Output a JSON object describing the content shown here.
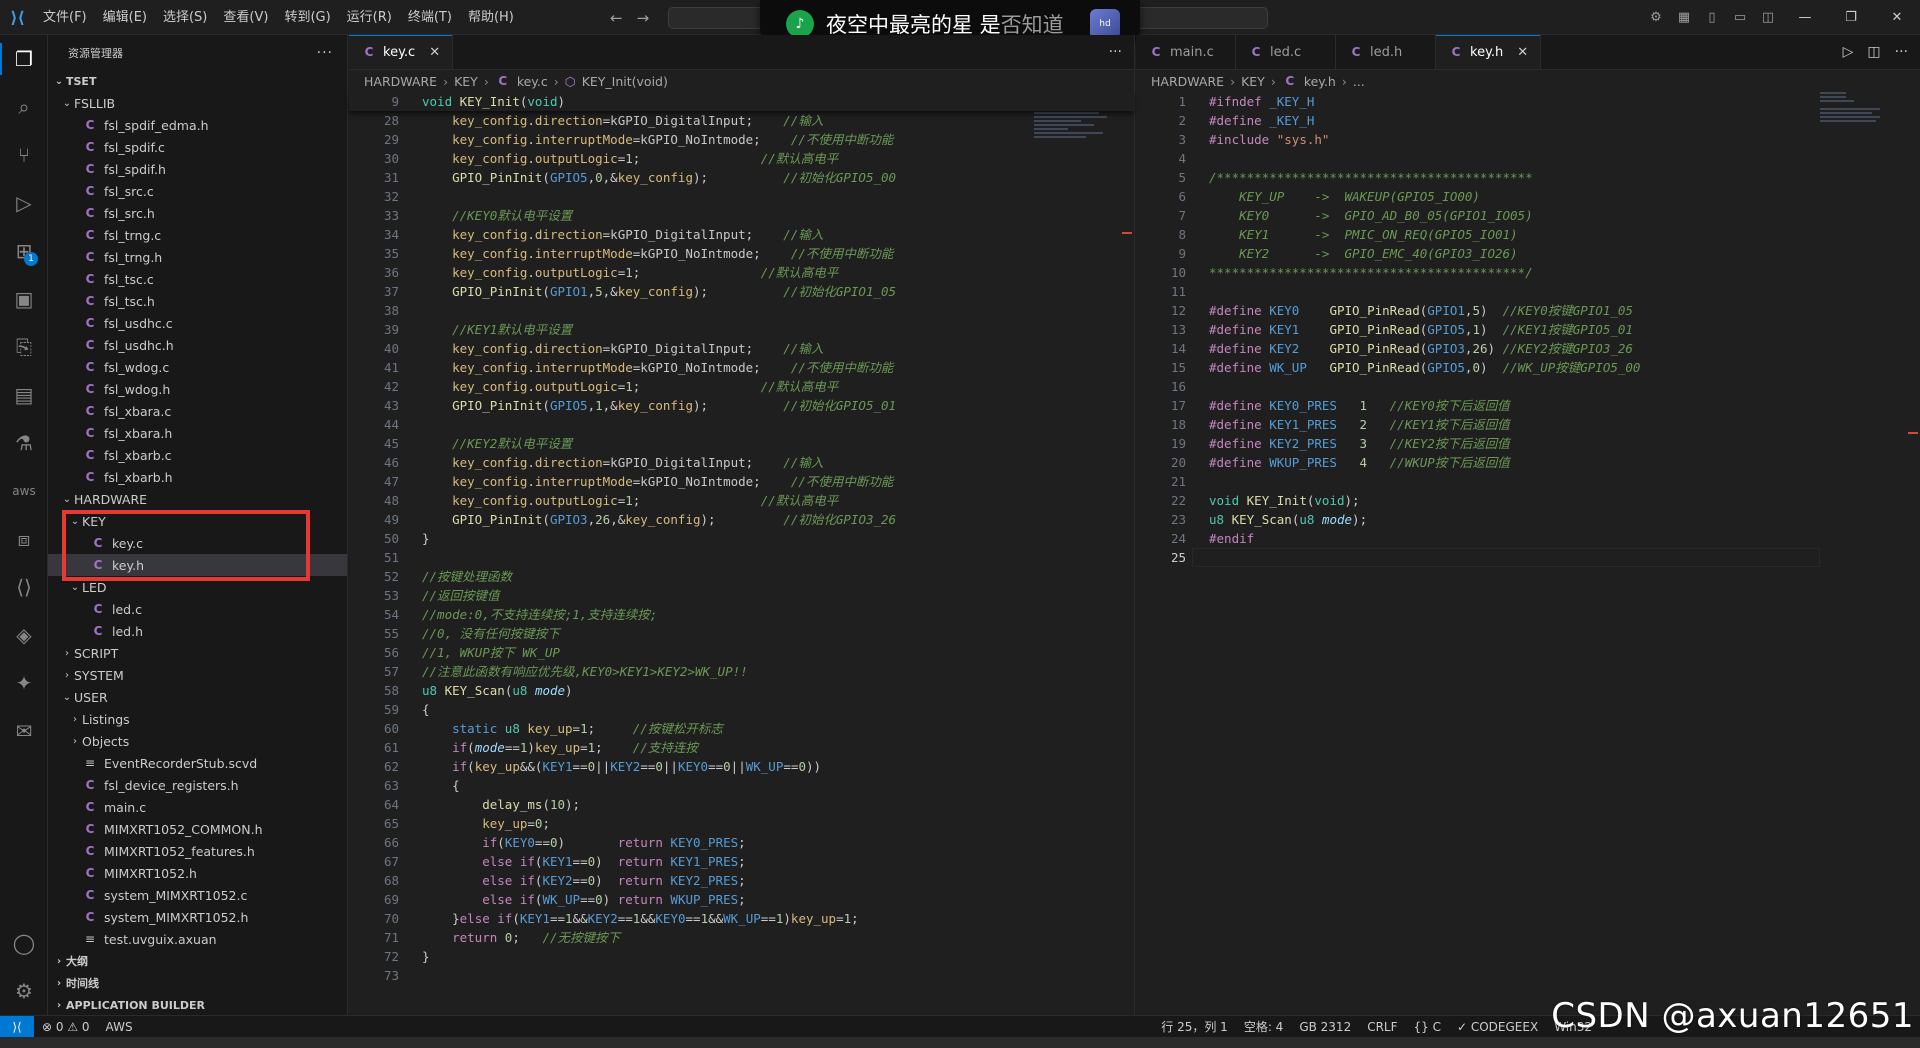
{
  "menu": [
    "文件(F)",
    "编辑(E)",
    "选择(S)",
    "查看(V)",
    "转到(G)",
    "运行(R)",
    "终端(T)",
    "帮助(H)"
  ],
  "notification": {
    "text": "夜空中最亮的星 是",
    "fade_text": "否知道",
    "thumb_label": "hd"
  },
  "activity_badge": "1",
  "sidebar": {
    "header": "资源管理器",
    "root": "TSET",
    "tree": [
      {
        "label": "FSLLIB",
        "depth": 1,
        "type": "folder",
        "open": true
      },
      {
        "label": "fsl_spdif_edma.h",
        "depth": 2,
        "type": "c"
      },
      {
        "label": "fsl_spdif.c",
        "depth": 2,
        "type": "c"
      },
      {
        "label": "fsl_spdif.h",
        "depth": 2,
        "type": "c"
      },
      {
        "label": "fsl_src.c",
        "depth": 2,
        "type": "c"
      },
      {
        "label": "fsl_src.h",
        "depth": 2,
        "type": "c"
      },
      {
        "label": "fsl_trng.c",
        "depth": 2,
        "type": "c"
      },
      {
        "label": "fsl_trng.h",
        "depth": 2,
        "type": "c"
      },
      {
        "label": "fsl_tsc.c",
        "depth": 2,
        "type": "c"
      },
      {
        "label": "fsl_tsc.h",
        "depth": 2,
        "type": "c"
      },
      {
        "label": "fsl_usdhc.c",
        "depth": 2,
        "type": "c"
      },
      {
        "label": "fsl_usdhc.h",
        "depth": 2,
        "type": "c"
      },
      {
        "label": "fsl_wdog.c",
        "depth": 2,
        "type": "c"
      },
      {
        "label": "fsl_wdog.h",
        "depth": 2,
        "type": "c"
      },
      {
        "label": "fsl_xbara.c",
        "depth": 2,
        "type": "c"
      },
      {
        "label": "fsl_xbara.h",
        "depth": 2,
        "type": "c"
      },
      {
        "label": "fsl_xbarb.c",
        "depth": 2,
        "type": "c"
      },
      {
        "label": "fsl_xbarb.h",
        "depth": 2,
        "type": "c"
      },
      {
        "label": "HARDWARE",
        "depth": 1,
        "type": "folder",
        "open": true
      },
      {
        "label": "KEY",
        "depth": 2,
        "type": "folder",
        "open": true
      },
      {
        "label": "key.c",
        "depth": 3,
        "type": "c"
      },
      {
        "label": "key.h",
        "depth": 3,
        "type": "c",
        "selected": true
      },
      {
        "label": "LED",
        "depth": 2,
        "type": "folder",
        "open": true
      },
      {
        "label": "led.c",
        "depth": 3,
        "type": "c"
      },
      {
        "label": "led.h",
        "depth": 3,
        "type": "c"
      },
      {
        "label": "SCRIPT",
        "depth": 1,
        "type": "folder",
        "open": false
      },
      {
        "label": "SYSTEM",
        "depth": 1,
        "type": "folder",
        "open": false
      },
      {
        "label": "USER",
        "depth": 1,
        "type": "folder",
        "open": true
      },
      {
        "label": "Listings",
        "depth": 2,
        "type": "folder",
        "open": false
      },
      {
        "label": "Objects",
        "depth": 2,
        "type": "folder",
        "open": false
      },
      {
        "label": "EventRecorderStub.scvd",
        "depth": 2,
        "type": "lines"
      },
      {
        "label": "fsl_device_registers.h",
        "depth": 2,
        "type": "c"
      },
      {
        "label": "main.c",
        "depth": 2,
        "type": "c"
      },
      {
        "label": "MIMXRT1052_COMMON.h",
        "depth": 2,
        "type": "c"
      },
      {
        "label": "MIMXRT1052_features.h",
        "depth": 2,
        "type": "c"
      },
      {
        "label": "MIMXRT1052.h",
        "depth": 2,
        "type": "c"
      },
      {
        "label": "system_MIMXRT1052.c",
        "depth": 2,
        "type": "c"
      },
      {
        "label": "system_MIMXRT1052.h",
        "depth": 2,
        "type": "c"
      },
      {
        "label": "test.uvguix.axuan",
        "depth": 2,
        "type": "lines"
      }
    ],
    "sections": [
      "大纲",
      "时间线",
      "APPLICATION BUILDER"
    ]
  },
  "left_editor": {
    "tabs": [
      {
        "label": "key.c",
        "active": true
      }
    ],
    "breadcrumb": [
      "HARDWARE",
      "KEY",
      "key.c",
      "KEY_Init(void)"
    ],
    "sticky": {
      "ln": "9",
      "html": "<span class='t'>void</span> <span class='f'>KEY_Init</span>(<span class='t'>void</span>)"
    },
    "lines": [
      {
        "ln": "28",
        "html": "    <span class='v'>key_config</span>.<span class='v'>direction</span>=<span class='m'>kGPIO_DigitalInput</span>;    <span class='cmt'>//输入</span>"
      },
      {
        "ln": "29",
        "html": "    <span class='v'>key_config</span>.<span class='v'>interruptMode</span>=<span class='m'>kGPIO_NoIntmode</span>;    <span class='cmt'>//不使用中断功能</span>"
      },
      {
        "ln": "30",
        "html": "    <span class='v'>key_config</span>.<span class='v'>outputLogic</span>=<span class='n'>1</span>;                <span class='cmt'>//默认高电平</span>"
      },
      {
        "ln": "31",
        "html": "    <span class='f'>GPIO_PinInit</span>(<span class='k'>GPIO5</span>,<span class='n'>0</span>,&amp;<span class='v'>key_config</span>);          <span class='cmt'>//初始化GPIO5_00</span>"
      },
      {
        "ln": "32",
        "html": ""
      },
      {
        "ln": "33",
        "html": "    <span class='cmt'>//KEY0默认电平设置</span>"
      },
      {
        "ln": "34",
        "html": "    <span class='v'>key_config</span>.<span class='v'>direction</span>=<span class='m'>kGPIO_DigitalInput</span>;    <span class='cmt'>//输入</span>"
      },
      {
        "ln": "35",
        "html": "    <span class='v'>key_config</span>.<span class='v'>interruptMode</span>=<span class='m'>kGPIO_NoIntmode</span>;    <span class='cmt'>//不使用中断功能</span>"
      },
      {
        "ln": "36",
        "html": "    <span class='v'>key_config</span>.<span class='v'>outputLogic</span>=<span class='n'>1</span>;                <span class='cmt'>//默认高电平</span>"
      },
      {
        "ln": "37",
        "html": "    <span class='f'>GPIO_PinInit</span>(<span class='k'>GPIO1</span>,<span class='n'>5</span>,&amp;<span class='v'>key_config</span>);          <span class='cmt'>//初始化GPIO1_05</span>"
      },
      {
        "ln": "38",
        "html": ""
      },
      {
        "ln": "39",
        "html": "    <span class='cmt'>//KEY1默认电平设置</span>"
      },
      {
        "ln": "40",
        "html": "    <span class='v'>key_config</span>.<span class='v'>direction</span>=<span class='m'>kGPIO_DigitalInput</span>;    <span class='cmt'>//输入</span>"
      },
      {
        "ln": "41",
        "html": "    <span class='v'>key_config</span>.<span class='v'>interruptMode</span>=<span class='m'>kGPIO_NoIntmode</span>;    <span class='cmt'>//不使用中断功能</span>"
      },
      {
        "ln": "42",
        "html": "    <span class='v'>key_config</span>.<span class='v'>outputLogic</span>=<span class='n'>1</span>;                <span class='cmt'>//默认高电平</span>"
      },
      {
        "ln": "43",
        "html": "    <span class='f'>GPIO_PinInit</span>(<span class='k'>GPIO5</span>,<span class='n'>1</span>,&amp;<span class='v'>key_config</span>);          <span class='cmt'>//初始化GPIO5_01</span>"
      },
      {
        "ln": "44",
        "html": ""
      },
      {
        "ln": "45",
        "html": "    <span class='cmt'>//KEY2默认电平设置</span>"
      },
      {
        "ln": "46",
        "html": "    <span class='v'>key_config</span>.<span class='v'>direction</span>=<span class='m'>kGPIO_DigitalInput</span>;    <span class='cmt'>//输入</span>"
      },
      {
        "ln": "47",
        "html": "    <span class='v'>key_config</span>.<span class='v'>interruptMode</span>=<span class='m'>kGPIO_NoIntmode</span>;    <span class='cmt'>//不使用中断功能</span>"
      },
      {
        "ln": "48",
        "html": "    <span class='v'>key_config</span>.<span class='v'>outputLogic</span>=<span class='n'>1</span>;                <span class='cmt'>//默认高电平</span>"
      },
      {
        "ln": "49",
        "html": "    <span class='f'>GPIO_PinInit</span>(<span class='k'>GPIO3</span>,<span class='n'>26</span>,&amp;<span class='v'>key_config</span>);         <span class='cmt'>//初始化GPIO3_26</span>"
      },
      {
        "ln": "50",
        "html": "}"
      },
      {
        "ln": "51",
        "html": ""
      },
      {
        "ln": "52",
        "html": "<span class='cmt'>//按键处理函数</span>"
      },
      {
        "ln": "53",
        "html": "<span class='cmt'>//返回按键值</span>"
      },
      {
        "ln": "54",
        "html": "<span class='cmt'>//mode:0,不支持连续按;1,支持连续按;</span>"
      },
      {
        "ln": "55",
        "html": "<span class='cmt'>//0, 没有任何按键按下</span>"
      },
      {
        "ln": "56",
        "html": "<span class='cmt'>//1, WKUP按下 WK_UP</span>"
      },
      {
        "ln": "57",
        "html": "<span class='cmt'>//注意此函数有响应优先级,KEY0&gt;KEY1&gt;KEY2&gt;WK_UP!!</span>"
      },
      {
        "ln": "58",
        "html": "<span class='t'>u8</span> <span class='f'>KEY_Scan</span>(<span class='t'>u8</span> <span class='p'>mode</span>)"
      },
      {
        "ln": "59",
        "html": "{"
      },
      {
        "ln": "60",
        "html": "    <span class='k'>static</span> <span class='t'>u8</span> <span class='v'>key_up</span>=<span class='n'>1</span>;     <span class='cmt'>//按键松开标志</span>"
      },
      {
        "ln": "61",
        "html": "    <span class='ctrl'>if</span>(<span class='p'>mode</span>==<span class='n'>1</span>)<span class='v'>key_up</span>=<span class='n'>1</span>;    <span class='cmt'>//支持连按</span>"
      },
      {
        "ln": "62",
        "html": "    <span class='ctrl'>if</span>(<span class='v'>key_up</span>&amp;&amp;(<span class='k'>KEY1</span>==<span class='n'>0</span>||<span class='k'>KEY2</span>==<span class='n'>0</span>||<span class='k'>KEY0</span>==<span class='n'>0</span>||<span class='k'>WK_UP</span>==<span class='n'>0</span>))"
      },
      {
        "ln": "63",
        "html": "    {"
      },
      {
        "ln": "64",
        "html": "        <span class='f'>delay_ms</span>(<span class='n'>10</span>);"
      },
      {
        "ln": "65",
        "html": "        <span class='v'>key_up</span>=<span class='n'>0</span>;"
      },
      {
        "ln": "66",
        "html": "        <span class='ctrl'>if</span>(<span class='k'>KEY0</span>==<span class='n'>0</span>)       <span class='ctrl'>return</span> <span class='k'>KEY0_PRES</span>;"
      },
      {
        "ln": "67",
        "html": "        <span class='ctrl'>else if</span>(<span class='k'>KEY1</span>==<span class='n'>0</span>)  <span class='ctrl'>return</span> <span class='k'>KEY1_PRES</span>;"
      },
      {
        "ln": "68",
        "html": "        <span class='ctrl'>else if</span>(<span class='k'>KEY2</span>==<span class='n'>0</span>)  <span class='ctrl'>return</span> <span class='k'>KEY2_PRES</span>;"
      },
      {
        "ln": "69",
        "html": "        <span class='ctrl'>else if</span>(<span class='k'>WK_UP</span>==<span class='n'>0</span>) <span class='ctrl'>return</span> <span class='k'>WKUP_PRES</span>;"
      },
      {
        "ln": "70",
        "html": "    }<span class='ctrl'>else if</span>(<span class='k'>KEY1</span>==<span class='n'>1</span>&amp;&amp;<span class='k'>KEY2</span>==<span class='n'>1</span>&amp;&amp;<span class='k'>KEY0</span>==<span class='n'>1</span>&amp;&amp;<span class='k'>WK_UP</span>==<span class='n'>1</span>)<span class='v'>key_up</span>=<span class='n'>1</span>;"
      },
      {
        "ln": "71",
        "html": "    <span class='ctrl'>return</span> <span class='n'>0</span>;   <span class='cmt'>//无按键按下</span>"
      },
      {
        "ln": "72",
        "html": "}"
      },
      {
        "ln": "73",
        "html": ""
      }
    ]
  },
  "right_editor": {
    "tabs": [
      {
        "label": "main.c",
        "active": false
      },
      {
        "label": "led.c",
        "active": false
      },
      {
        "label": "led.h",
        "active": false
      },
      {
        "label": "key.h",
        "active": true
      }
    ],
    "breadcrumb": [
      "HARDWARE",
      "KEY",
      "key.h",
      "..."
    ],
    "lines": [
      {
        "ln": "1",
        "html": "<span class='pp'>#ifndef</span> <span class='k'>_KEY_H</span>"
      },
      {
        "ln": "2",
        "html": "<span class='pp'>#define</span> <span class='k'>_KEY_H</span>"
      },
      {
        "ln": "3",
        "html": "<span class='pp'>#include</span> <span class='s'>\"sys.h\"</span>"
      },
      {
        "ln": "4",
        "html": ""
      },
      {
        "ln": "5",
        "html": "<span class='cmt'>/******************************************</span>"
      },
      {
        "ln": "6",
        "html": "<span class='cmt'>    KEY_UP    -&gt;  WAKEUP(GPIO5_IO00)</span>"
      },
      {
        "ln": "7",
        "html": "<span class='cmt'>    KEY0      -&gt;  GPIO_AD_B0_05(GPIO1_IO05)</span>"
      },
      {
        "ln": "8",
        "html": "<span class='cmt'>    KEY1      -&gt;  PMIC_ON_REQ(GPIO5_IO01)</span>"
      },
      {
        "ln": "9",
        "html": "<span class='cmt'>    KEY2      -&gt;  GPIO_EMC_40(GPIO3_IO26)</span>"
      },
      {
        "ln": "10",
        "html": "<span class='cmt'>******************************************/</span>"
      },
      {
        "ln": "11",
        "html": ""
      },
      {
        "ln": "12",
        "html": "<span class='pp'>#define</span> <span class='k'>KEY0</span>    <span class='f'>GPIO_PinRead</span>(<span class='k'>GPIO1</span>,<span class='n'>5</span>)  <span class='cmt'>//KEY0按键GPIO1_05</span>"
      },
      {
        "ln": "13",
        "html": "<span class='pp'>#define</span> <span class='k'>KEY1</span>    <span class='f'>GPIO_PinRead</span>(<span class='k'>GPIO5</span>,<span class='n'>1</span>)  <span class='cmt'>//KEY1按键GPIO5_01</span>"
      },
      {
        "ln": "14",
        "html": "<span class='pp'>#define</span> <span class='k'>KEY2</span>    <span class='f'>GPIO_PinRead</span>(<span class='k'>GPIO3</span>,<span class='n'>26</span>) <span class='cmt'>//KEY2按键GPIO3_26</span>"
      },
      {
        "ln": "15",
        "html": "<span class='pp'>#define</span> <span class='k'>WK_UP</span>   <span class='f'>GPIO_PinRead</span>(<span class='k'>GPIO5</span>,<span class='n'>0</span>)  <span class='cmt'>//WK_UP按键GPIO5_00</span>"
      },
      {
        "ln": "16",
        "html": ""
      },
      {
        "ln": "17",
        "html": "<span class='pp'>#define</span> <span class='k'>KEY0_PRES</span>   <span class='n'>1</span>   <span class='cmt'>//KEY0按下后返回值</span>"
      },
      {
        "ln": "18",
        "html": "<span class='pp'>#define</span> <span class='k'>KEY1_PRES</span>   <span class='n'>2</span>   <span class='cmt'>//KEY1按下后返回值</span>"
      },
      {
        "ln": "19",
        "html": "<span class='pp'>#define</span> <span class='k'>KEY2_PRES</span>   <span class='n'>3</span>   <span class='cmt'>//KEY2按下后返回值</span>"
      },
      {
        "ln": "20",
        "html": "<span class='pp'>#define</span> <span class='k'>WKUP_PRES</span>   <span class='n'>4</span>   <span class='cmt'>//WKUP按下后返回值</span>"
      },
      {
        "ln": "21",
        "html": ""
      },
      {
        "ln": "22",
        "html": "<span class='t'>void</span> <span class='f'>KEY_Init</span>(<span class='t'>void</span>);"
      },
      {
        "ln": "23",
        "html": "<span class='t'>u8</span> <span class='f'>KEY_Scan</span>(<span class='t'>u8</span> <span class='p'>mode</span>);"
      },
      {
        "ln": "24",
        "html": "<span class='pp'>#endif</span>"
      },
      {
        "ln": "25",
        "html": "",
        "current": true
      }
    ]
  },
  "statusbar": {
    "errors": "⊗ 0 ⚠ 0",
    "aws": "AWS",
    "position": "行 25，列 1",
    "spaces": "空格: 4",
    "encoding": "GB 2312",
    "eol": "CRLF",
    "lang": "{} C",
    "codegeex": "✓ CODEGEEX",
    "platform": "Win32"
  },
  "watermark": "CSDN @axuan12651",
  "colors": {
    "accent": "#0078d4",
    "highlight_box": "#e53935"
  }
}
